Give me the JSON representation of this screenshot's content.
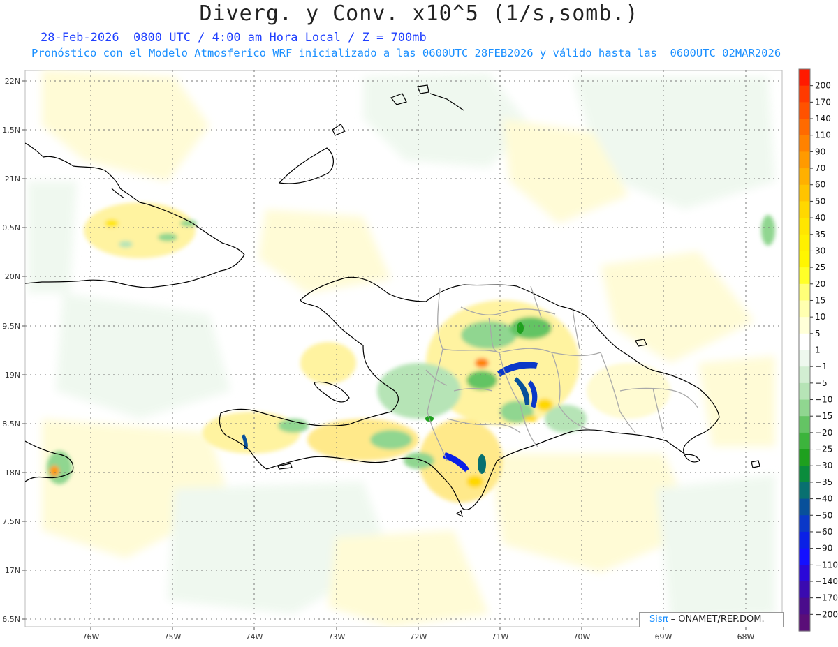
{
  "title": "Diverg. y Conv. x10^5 (1/s,somb.)",
  "subtitle_date": "28-Feb-2026  0800 UTC / 4:00 am Hora Local / Z = 700mb",
  "subtitle_model": "Pronóstico con el Modelo Atmosferico WRF inicializado a las 0600UTC_28FEB2026 y válido hasta las  0600UTC_02MAR2026",
  "credit": {
    "brand": "Sisπ",
    "text": " – ONAMET/REP.DOM."
  },
  "lat_labels": [
    "22N",
    "1.5N",
    "21N",
    "0.5N",
    "20N",
    "9.5N",
    "19N",
    "8.5N",
    "18N",
    "7.5N",
    "17N",
    "6.5N"
  ],
  "lon_labels": [
    "76W",
    "75W",
    "74W",
    "73W",
    "72W",
    "71W",
    "70W",
    "69W",
    "68W"
  ],
  "colorbar": {
    "labels": [
      "200",
      "170",
      "140",
      "110",
      "90",
      "70",
      "60",
      "50",
      "40",
      "35",
      "30",
      "25",
      "20",
      "15",
      "10",
      "5",
      "1",
      "−1",
      "−5",
      "−10",
      "−15",
      "−20",
      "−25",
      "−30",
      "−35",
      "−40",
      "−50",
      "−60",
      "−90",
      "−110",
      "−140",
      "−170",
      "−200"
    ],
    "colors": [
      "#ff1a00",
      "#ff3a00",
      "#ff5200",
      "#ff6a00",
      "#ff8200",
      "#ff9a00",
      "#ffb000",
      "#ffc400",
      "#ffd800",
      "#ffe600",
      "#fff000",
      "#fff600",
      "#ffff28",
      "#ffff78",
      "#ffffb0",
      "#ffffd8",
      "#ffffff",
      "#eef8ee",
      "#d2eed2",
      "#b6e4b6",
      "#90d690",
      "#64c464",
      "#3cb43c",
      "#1ea01e",
      "#0a8c3c",
      "#087070",
      "#08509a",
      "#0a38c8",
      "#0a20e6",
      "#1410ff",
      "#2a08d8",
      "#3a0ab0",
      "#4a0c8c",
      "#5a0e78"
    ]
  },
  "colors": {
    "title": "#222222",
    "subtitle_date": "#1f3fff",
    "subtitle_model": "#1a8fff",
    "coastline": "#000000",
    "borders": "#a8a8a8"
  }
}
